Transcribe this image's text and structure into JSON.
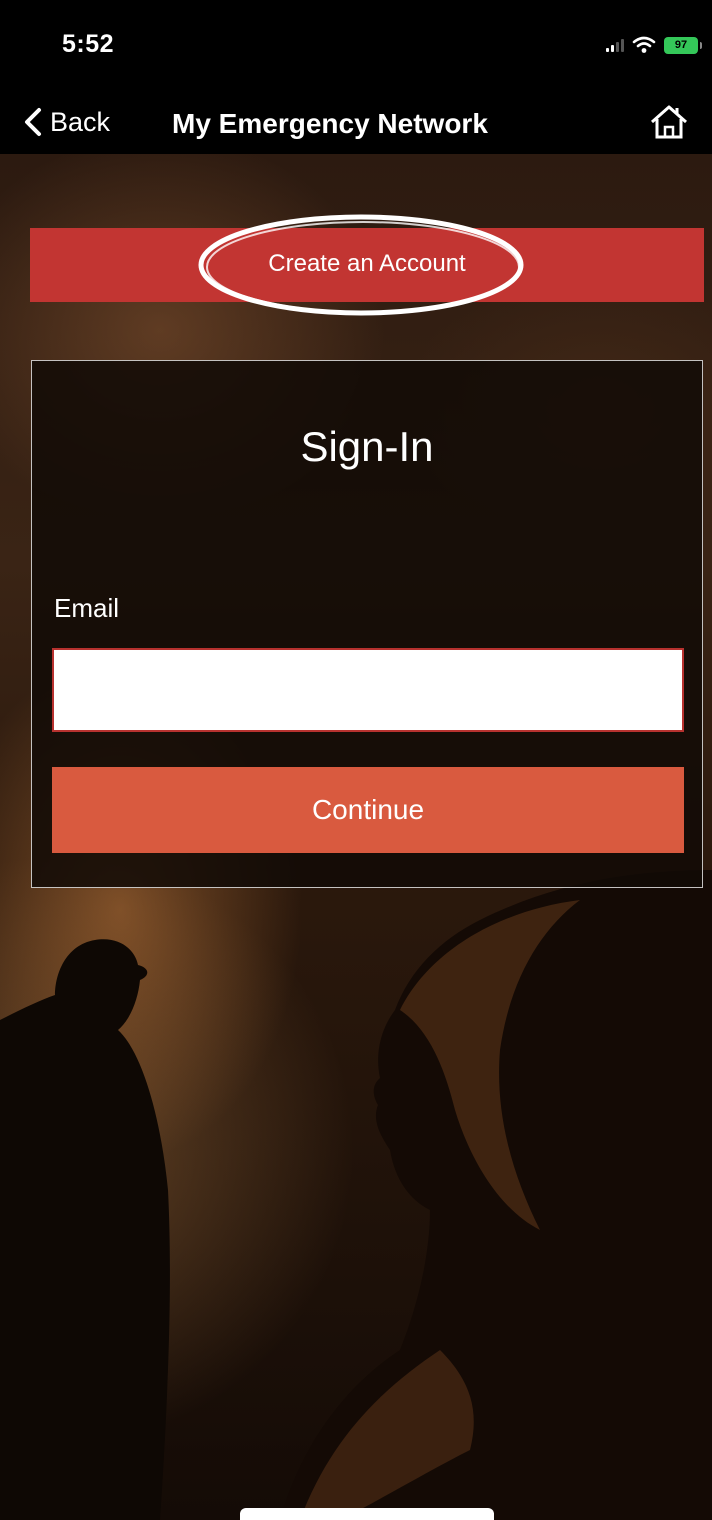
{
  "status_bar": {
    "time": "5:52",
    "battery": "97",
    "icons": [
      "signal-icon",
      "wifi-icon",
      "battery-icon"
    ]
  },
  "nav": {
    "back_label": "Back",
    "title": "My Emergency Network",
    "home_icon": "home-icon"
  },
  "create_account": {
    "label": "Create an Account",
    "highlighted": true
  },
  "signin": {
    "title": "Sign-In",
    "email_label": "Email",
    "email_value": "",
    "continue_label": "Continue"
  },
  "colors": {
    "create_account_bg": "#c23532",
    "continue_bg": "#d95a3f",
    "battery_green": "#34c759"
  }
}
